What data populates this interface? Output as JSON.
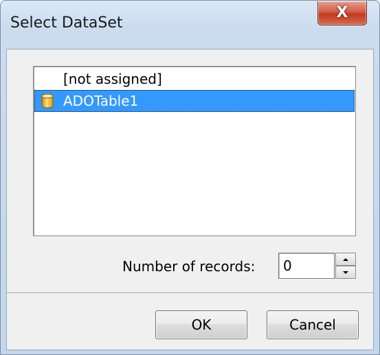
{
  "window": {
    "title": "Select DataSet",
    "close_glyph": "X"
  },
  "list": {
    "items": [
      {
        "label": "[not assigned]",
        "icon": "none",
        "selected": false
      },
      {
        "label": "ADOTable1",
        "icon": "database-icon",
        "selected": true
      }
    ]
  },
  "records": {
    "label": "Number of records:",
    "value": "0"
  },
  "buttons": {
    "ok_label": "OK",
    "cancel_label": "Cancel"
  },
  "colors": {
    "selection": "#3399ff",
    "close_button": "#c23a22",
    "dialog_face": "#f0f0f0",
    "frame": "#c3d6ec"
  }
}
